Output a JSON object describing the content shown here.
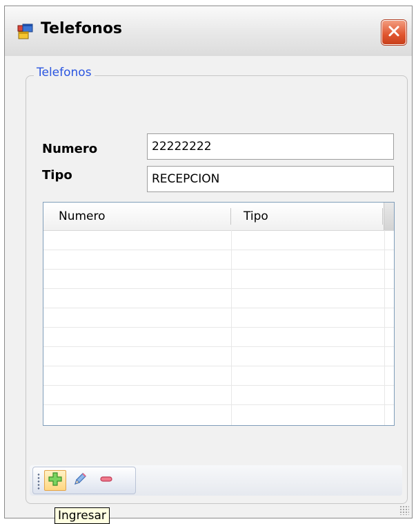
{
  "window": {
    "title": "Telefonos",
    "icons": {
      "app": "form-window-icon",
      "close": "close-icon"
    }
  },
  "group": {
    "title": "Telefonos"
  },
  "form": {
    "numero_label": "Numero",
    "numero_value": "22222222",
    "tipo_label": "Tipo",
    "tipo_value": "RECEPCION"
  },
  "grid": {
    "columns": [
      "Numero",
      "Tipo"
    ],
    "rows": []
  },
  "toolbar": {
    "buttons": [
      {
        "icon": "plus-icon",
        "hovered": true
      },
      {
        "icon": "pencil-icon",
        "hovered": false
      },
      {
        "icon": "minus-icon",
        "hovered": false
      }
    ],
    "tooltip": "Ingresar"
  },
  "colors": {
    "group_title": "#2a55e0",
    "close_button": "#e0552f",
    "add_icon": "#4db33d",
    "remove_icon": "#e0475e",
    "edit_icon": "#5b8fd6"
  }
}
